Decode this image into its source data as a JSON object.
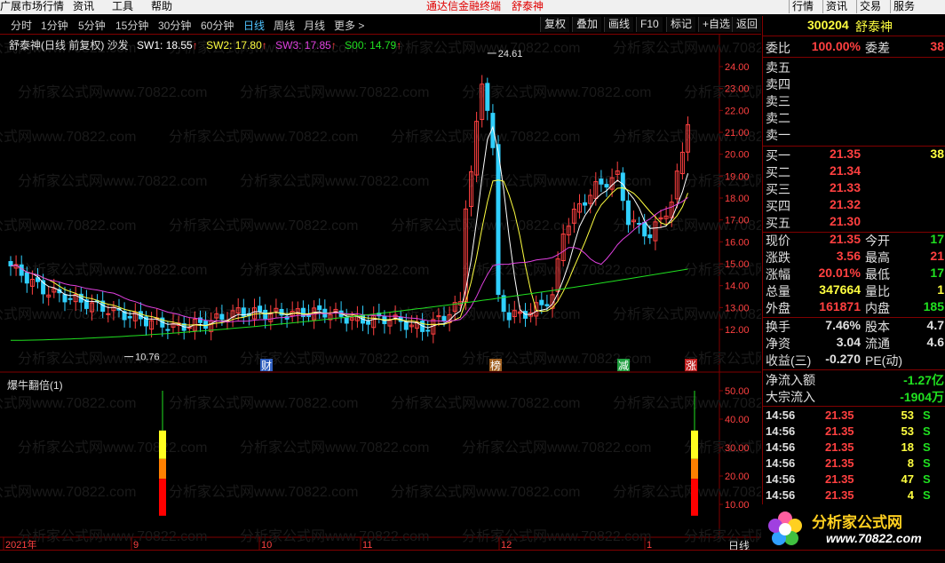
{
  "menu": {
    "items": [
      "广展市场行情",
      "资讯",
      "工具",
      "帮助"
    ],
    "title": "通达信金融终端",
    "stock_name_title": "舒泰神",
    "right_buttons": [
      "行情",
      "资讯",
      "交易",
      "服务"
    ]
  },
  "period_bar": {
    "items": [
      "分时",
      "1分钟",
      "5分钟",
      "15分钟",
      "30分钟",
      "60分钟",
      "日线",
      "周线",
      "月线",
      "更多 >"
    ],
    "active": "日线",
    "tools": [
      "复权",
      "叠加",
      "画线",
      "F10",
      "标记",
      "+自选",
      "返回"
    ]
  },
  "legend": {
    "title": "舒泰神(日线 前复权) 沙发",
    "sw1": "SW1: 18.55",
    "sw2": "SW2: 17.80",
    "sw3": "SW3: 17.85",
    "s00": "S00: 14.79",
    "arrow": "↑"
  },
  "colors": {
    "up": "#ff4040",
    "down": "#30d0ff",
    "sw1": "#ffffff",
    "sw2": "#ffff40",
    "sw3": "#e040e0",
    "s00": "#20e020",
    "grid": "#800000"
  },
  "chart": {
    "high_label": "24.61",
    "low_label": "10.76",
    "y_ticks": [
      "24.00",
      "23.00",
      "22.00",
      "21.00",
      "20.00",
      "19.00",
      "18.00",
      "17.00",
      "16.00",
      "15.00",
      "14.00",
      "13.00",
      "12.00"
    ],
    "event_tags": [
      "财",
      "榜",
      "减",
      "涨"
    ],
    "ind_title": "爆牛翻倍(1)",
    "ind_y_ticks": [
      "50.00",
      "40.00",
      "30.00",
      "20.00",
      "10.00"
    ],
    "x_labels": [
      "2021年",
      "9",
      "10",
      "11",
      "12",
      "1"
    ],
    "period_label": "日线",
    "watermark": "分析家公式网www.70822.com"
  },
  "chart_data": {
    "type": "candlestick",
    "ylim": [
      11,
      25
    ],
    "high": 24.61,
    "low": 10.76,
    "last_close": 21.35
  },
  "quote": {
    "code": "300204",
    "name": "舒泰神",
    "weibi_label": "委比",
    "weibi": "100.00%",
    "weicha_label": "委差",
    "weicha": "38",
    "asks": [
      {
        "label": "卖五",
        "price": "",
        "vol": ""
      },
      {
        "label": "卖四",
        "price": "",
        "vol": ""
      },
      {
        "label": "卖三",
        "price": "",
        "vol": ""
      },
      {
        "label": "卖二",
        "price": "",
        "vol": ""
      },
      {
        "label": "卖一",
        "price": "",
        "vol": ""
      }
    ],
    "bids": [
      {
        "label": "买一",
        "price": "21.35",
        "vol": "38"
      },
      {
        "label": "买二",
        "price": "21.34",
        "vol": ""
      },
      {
        "label": "买三",
        "price": "21.33",
        "vol": ""
      },
      {
        "label": "买四",
        "price": "21.32",
        "vol": ""
      },
      {
        "label": "买五",
        "price": "21.30",
        "vol": ""
      }
    ],
    "stats": [
      {
        "l1": "现价",
        "v1": "21.35",
        "l2": "今开",
        "v2": "17",
        "c1": "red",
        "c2": "green"
      },
      {
        "l1": "涨跌",
        "v1": "3.56",
        "l2": "最高",
        "v2": "21",
        "c1": "red",
        "c2": "red"
      },
      {
        "l1": "涨幅",
        "v1": "20.01%",
        "l2": "最低",
        "v2": "17",
        "c1": "red",
        "c2": "green"
      },
      {
        "l1": "总量",
        "v1": "347664",
        "l2": "量比",
        "v2": "1",
        "c1": "yellow",
        "c2": "yellow"
      },
      {
        "l1": "外盘",
        "v1": "161871",
        "l2": "内盘",
        "v2": "185",
        "c1": "red",
        "c2": "green"
      }
    ],
    "stats2": [
      {
        "l1": "换手",
        "v1": "7.46%",
        "l2": "股本",
        "v2": "4.7",
        "c1": "white",
        "c2": "white"
      },
      {
        "l1": "净资",
        "v1": "3.04",
        "l2": "流通",
        "v2": "4.6",
        "c1": "white",
        "c2": "white"
      },
      {
        "l1": "收益(三)",
        "v1": "-0.270",
        "l2": "PE(动)",
        "v2": "",
        "c1": "white",
        "c2": "white"
      }
    ],
    "flow": [
      {
        "label": "净流入额",
        "value": "-1.27亿"
      },
      {
        "label": "大宗流入",
        "value": "-1904万"
      }
    ],
    "ticks": [
      {
        "time": "14:56",
        "price": "21.35",
        "vol": "53",
        "side": "S"
      },
      {
        "time": "14:56",
        "price": "21.35",
        "vol": "53",
        "side": "S"
      },
      {
        "time": "14:56",
        "price": "21.35",
        "vol": "18",
        "side": "S"
      },
      {
        "time": "14:56",
        "price": "21.35",
        "vol": "8",
        "side": "S"
      },
      {
        "time": "14:56",
        "price": "21.35",
        "vol": "47",
        "side": "S"
      },
      {
        "time": "14:56",
        "price": "21.35",
        "vol": "4",
        "side": "S"
      }
    ]
  },
  "logo": {
    "name": "分析家公式网",
    "url": "www.70822.com"
  }
}
